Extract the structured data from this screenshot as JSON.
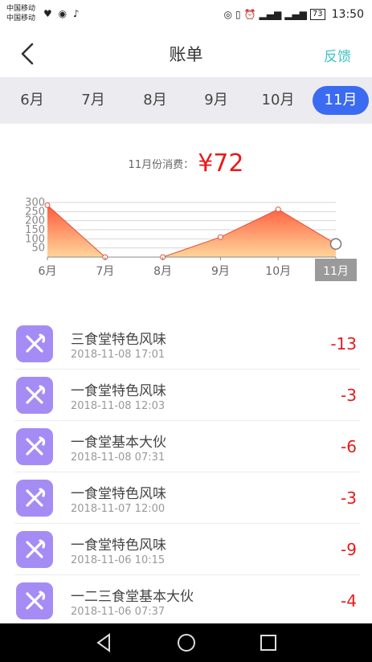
{
  "status": {
    "carrier1": "中国移动",
    "carrier2": "中国移动",
    "battery": "73",
    "time": "13:50"
  },
  "header": {
    "title": "账单",
    "feedback": "反馈"
  },
  "months": [
    "6月",
    "7月",
    "8月",
    "9月",
    "10月",
    "11月"
  ],
  "active_month_index": 5,
  "summary": {
    "label": "11月份消费：",
    "amount": "¥72"
  },
  "chart_data": {
    "type": "area",
    "categories": [
      "6月",
      "7月",
      "8月",
      "9月",
      "10月",
      "11月"
    ],
    "values": [
      285,
      0,
      0,
      110,
      262,
      72
    ],
    "yticks": [
      50,
      100,
      150,
      200,
      250,
      300
    ],
    "ylim": [
      0,
      300
    ],
    "colors": {
      "line": "#e0523a",
      "fill_top": "#ff5a3c",
      "fill_bottom": "#ffd59a",
      "active_label_bg": "#9a9a9a"
    }
  },
  "transactions": [
    {
      "name": "三食堂特色风味",
      "time": "2018-11-08 17:01",
      "amount": "-13"
    },
    {
      "name": "一食堂特色风味",
      "time": "2018-11-08 12:03",
      "amount": "-3"
    },
    {
      "name": "一食堂基本大伙",
      "time": "2018-11-08 07:31",
      "amount": "-6"
    },
    {
      "name": "一食堂特色风味",
      "time": "2018-11-07 12:00",
      "amount": "-3"
    },
    {
      "name": "一食堂特色风味",
      "time": "2018-11-06 10:15",
      "amount": "-9"
    },
    {
      "name": "一二三食堂基本大伙",
      "time": "2018-11-06 07:37",
      "amount": "-4"
    }
  ],
  "icons": {
    "transaction": "fork-knife-icon",
    "back": "chevron-left-icon"
  },
  "accent": {
    "active_tab": "#3b6bf0",
    "feedback": "#3ec3c6",
    "expense": "#e81a1a",
    "icon_bg": "#a58cf5"
  }
}
